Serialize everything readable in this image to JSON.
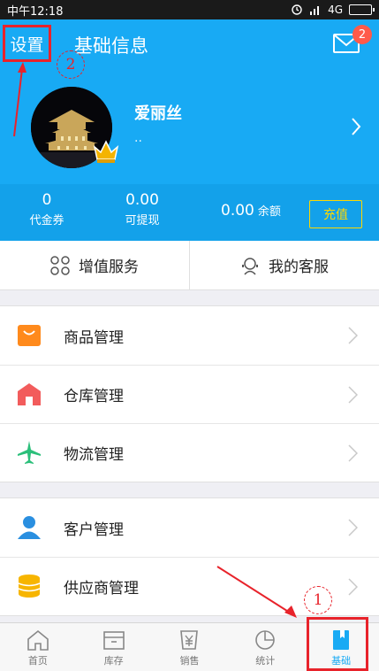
{
  "status_bar": {
    "time": "中午12:18",
    "network": "4G",
    "battery_level": 0.8
  },
  "header": {
    "settings_label": "设置",
    "title": "基础信息",
    "mail_badge": "2",
    "annotation_top": "2"
  },
  "profile": {
    "name": "爱丽丝",
    "subtitle": ".."
  },
  "stats": {
    "voucher_value": "0",
    "voucher_label": "代金券",
    "withdraw_value": "0.00",
    "withdraw_label": "可提现",
    "balance_value": "0.00",
    "balance_label": "余额",
    "recharge_label": "充值"
  },
  "services": [
    {
      "label": "增值服务",
      "icon": "grid-icon"
    },
    {
      "label": "我的客服",
      "icon": "headset-icon"
    }
  ],
  "menu_group_1": [
    {
      "label": "商品管理",
      "icon": "shopping-bag-icon"
    },
    {
      "label": "仓库管理",
      "icon": "warehouse-icon"
    },
    {
      "label": "物流管理",
      "icon": "airplane-icon"
    }
  ],
  "menu_group_2": [
    {
      "label": "客户管理",
      "icon": "customer-icon"
    },
    {
      "label": "供应商管理",
      "icon": "coins-icon"
    }
  ],
  "annotation_bottom": "1",
  "tabs": [
    {
      "label": "首页",
      "icon": "home-icon"
    },
    {
      "label": "库存",
      "icon": "box-icon"
    },
    {
      "label": "销售",
      "icon": "yen-icon"
    },
    {
      "label": "统计",
      "icon": "pie-chart-icon"
    },
    {
      "label": "基础",
      "icon": "book-icon",
      "active": true
    }
  ],
  "colors": {
    "primary": "#18aaf4",
    "annotation": "#e8232b",
    "recharge": "#ffd800"
  }
}
